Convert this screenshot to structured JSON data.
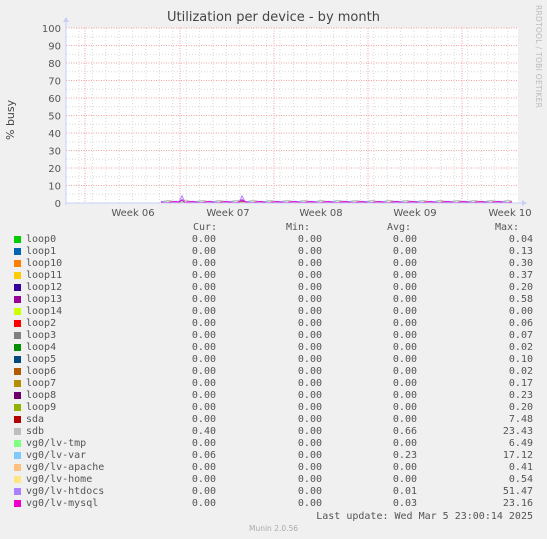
{
  "watermark": "RRDTOOL / TOBI OETIKER",
  "footer": "Munin 2.0.56",
  "last_update": "Last update: Wed Mar  5 23:00:14 2025",
  "legend_headers": {
    "cur": "Cur:",
    "min": "Min:",
    "avg": "Avg:",
    "max": "Max:"
  },
  "chart_data": {
    "type": "line",
    "title": "Utilization per device - by month",
    "xlabel": "",
    "ylabel": "% busy",
    "ylim": [
      0,
      100
    ],
    "yticks": [
      0,
      10,
      20,
      30,
      40,
      50,
      60,
      70,
      80,
      90,
      100
    ],
    "xticks": [
      "Week 06",
      "Week 07",
      "Week 08",
      "Week 09",
      "Week 10"
    ],
    "grid": true,
    "legend_position": "bottom",
    "series": [
      {
        "name": "loop0",
        "color": "#00cc00",
        "cur": "0.00",
        "min": "0.00",
        "avg": "0.00",
        "max": "0.04"
      },
      {
        "name": "loop1",
        "color": "#0066b3",
        "cur": "0.00",
        "min": "0.00",
        "avg": "0.00",
        "max": "0.13"
      },
      {
        "name": "loop10",
        "color": "#ff8000",
        "cur": "0.00",
        "min": "0.00",
        "avg": "0.00",
        "max": "0.30"
      },
      {
        "name": "loop11",
        "color": "#ffcc00",
        "cur": "0.00",
        "min": "0.00",
        "avg": "0.00",
        "max": "0.37"
      },
      {
        "name": "loop12",
        "color": "#330099",
        "cur": "0.00",
        "min": "0.00",
        "avg": "0.00",
        "max": "0.20"
      },
      {
        "name": "loop13",
        "color": "#990099",
        "cur": "0.00",
        "min": "0.00",
        "avg": "0.00",
        "max": "0.58"
      },
      {
        "name": "loop14",
        "color": "#ccff00",
        "cur": "0.00",
        "min": "0.00",
        "avg": "0.00",
        "max": "0.00"
      },
      {
        "name": "loop2",
        "color": "#ff0000",
        "cur": "0.00",
        "min": "0.00",
        "avg": "0.00",
        "max": "0.06"
      },
      {
        "name": "loop3",
        "color": "#808080",
        "cur": "0.00",
        "min": "0.00",
        "avg": "0.00",
        "max": "0.07"
      },
      {
        "name": "loop4",
        "color": "#008f00",
        "cur": "0.00",
        "min": "0.00",
        "avg": "0.00",
        "max": "0.02"
      },
      {
        "name": "loop5",
        "color": "#00487d",
        "cur": "0.00",
        "min": "0.00",
        "avg": "0.00",
        "max": "0.10"
      },
      {
        "name": "loop6",
        "color": "#b35a00",
        "cur": "0.00",
        "min": "0.00",
        "avg": "0.00",
        "max": "0.02"
      },
      {
        "name": "loop7",
        "color": "#b38f00",
        "cur": "0.00",
        "min": "0.00",
        "avg": "0.00",
        "max": "0.17"
      },
      {
        "name": "loop8",
        "color": "#6b006b",
        "cur": "0.00",
        "min": "0.00",
        "avg": "0.00",
        "max": "0.23"
      },
      {
        "name": "loop9",
        "color": "#8fb300",
        "cur": "0.00",
        "min": "0.00",
        "avg": "0.00",
        "max": "0.20"
      },
      {
        "name": "sda",
        "color": "#b30000",
        "cur": "0.00",
        "min": "0.00",
        "avg": "0.00",
        "max": "7.48"
      },
      {
        "name": "sdb",
        "color": "#bebebe",
        "cur": "0.40",
        "min": "0.00",
        "avg": "0.66",
        "max": "23.43"
      },
      {
        "name": "vg0/lv-tmp",
        "color": "#80ff80",
        "cur": "0.00",
        "min": "0.00",
        "avg": "0.00",
        "max": "6.49"
      },
      {
        "name": "vg0/lv-var",
        "color": "#80c9ff",
        "cur": "0.06",
        "min": "0.00",
        "avg": "0.23",
        "max": "17.12"
      },
      {
        "name": "vg0/lv-apache",
        "color": "#ffc080",
        "cur": "0.00",
        "min": "0.00",
        "avg": "0.00",
        "max": "0.41"
      },
      {
        "name": "vg0/lv-home",
        "color": "#ffe680",
        "cur": "0.00",
        "min": "0.00",
        "avg": "0.00",
        "max": "0.54"
      },
      {
        "name": "vg0/lv-htdocs",
        "color": "#aa80ff",
        "cur": "0.00",
        "min": "0.00",
        "avg": "0.01",
        "max": "51.47"
      },
      {
        "name": "vg0/lv-mysql",
        "color": "#ee00cc",
        "cur": "0.00",
        "min": "0.00",
        "avg": "0.03",
        "max": "23.16"
      }
    ]
  }
}
